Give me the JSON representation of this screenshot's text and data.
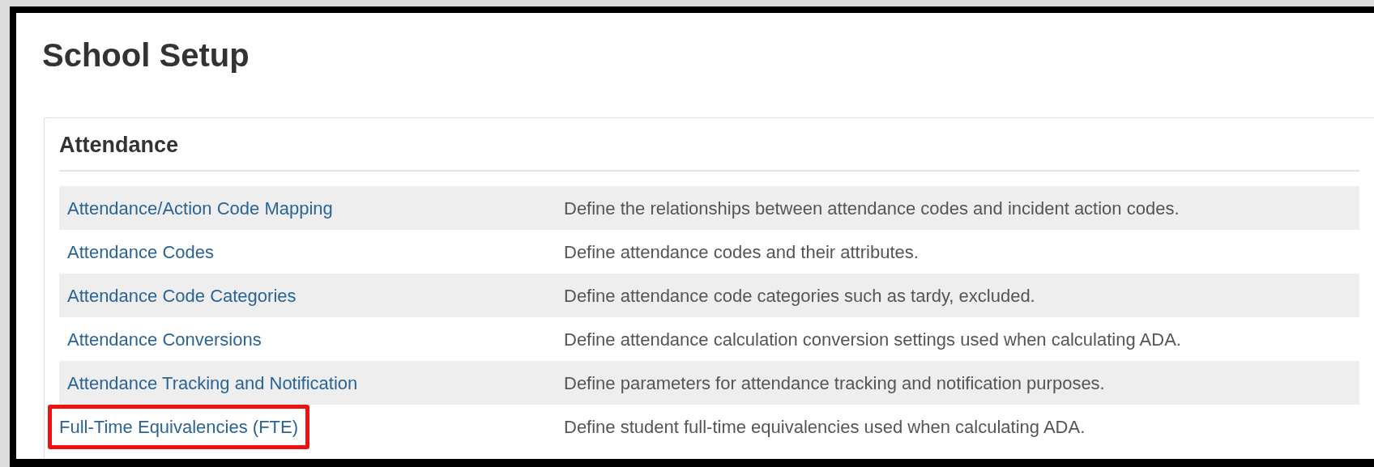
{
  "page_title": "School Setup",
  "panel": {
    "title": "Attendance",
    "rows": [
      {
        "link": "Attendance/Action Code Mapping",
        "description": "Define the relationships between attendance codes and incident action codes.",
        "highlighted": false
      },
      {
        "link": "Attendance Codes",
        "description": "Define attendance codes and their attributes.",
        "highlighted": false
      },
      {
        "link": "Attendance Code Categories",
        "description": "Define attendance code categories such as tardy, excluded.",
        "highlighted": false
      },
      {
        "link": "Attendance Conversions",
        "description": "Define attendance calculation conversion settings used when calculating ADA.",
        "highlighted": false
      },
      {
        "link": "Attendance Tracking and Notification",
        "description": "Define parameters for attendance tracking and notification purposes.",
        "highlighted": false
      },
      {
        "link": "Full-Time Equivalencies (FTE)",
        "description": "Define student full-time equivalencies used when calculating ADA.",
        "highlighted": true
      }
    ]
  }
}
